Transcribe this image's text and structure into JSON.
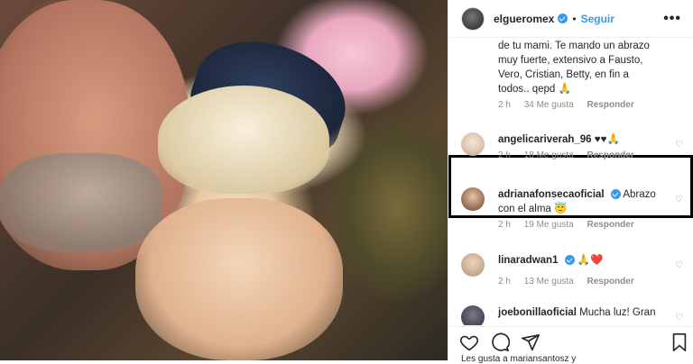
{
  "post": {
    "username": "elgueromex",
    "follow_label": "Seguir",
    "more_label": "•••",
    "dot": "•"
  },
  "comments": [
    {
      "username": "",
      "text_lines": [
        "de tu mami. Te mando un abrazo",
        "muy fuerte, extensivo a Fausto,",
        "Vero, Cristian, Betty, en fin a",
        "todos.. qepd 🙏"
      ],
      "time": "2 h",
      "likes": "34 Me gusta",
      "reply": "Responder"
    },
    {
      "username": "angelicariverah_96",
      "text": "♥♥🙏",
      "time": "2 h",
      "likes": "18 Me gusta",
      "reply": "Responder",
      "highlighted": true
    },
    {
      "username": "adrianafonsecaoficial",
      "verified": true,
      "text": "Abrazo",
      "text_line2": "con el alma 😇",
      "time": "2 h",
      "likes": "19 Me gusta",
      "reply": "Responder"
    },
    {
      "username": "linaradwan1",
      "verified": true,
      "text": "🙏❤️",
      "time": "2 h",
      "likes": "13 Me gusta",
      "reply": "Responder"
    },
    {
      "username": "joebonillaoficial",
      "text": "Mucha luz! Gran"
    }
  ],
  "footer": {
    "likes_text": "Les gusta a mariansantosz y"
  },
  "colors": {
    "accent": "#3897f0",
    "muted": "#8e8e8e",
    "highlight_border": "#000000"
  },
  "icons": [
    "heart-icon",
    "comment-icon",
    "share-icon",
    "bookmark-icon",
    "verified-icon",
    "more-options-icon"
  ]
}
